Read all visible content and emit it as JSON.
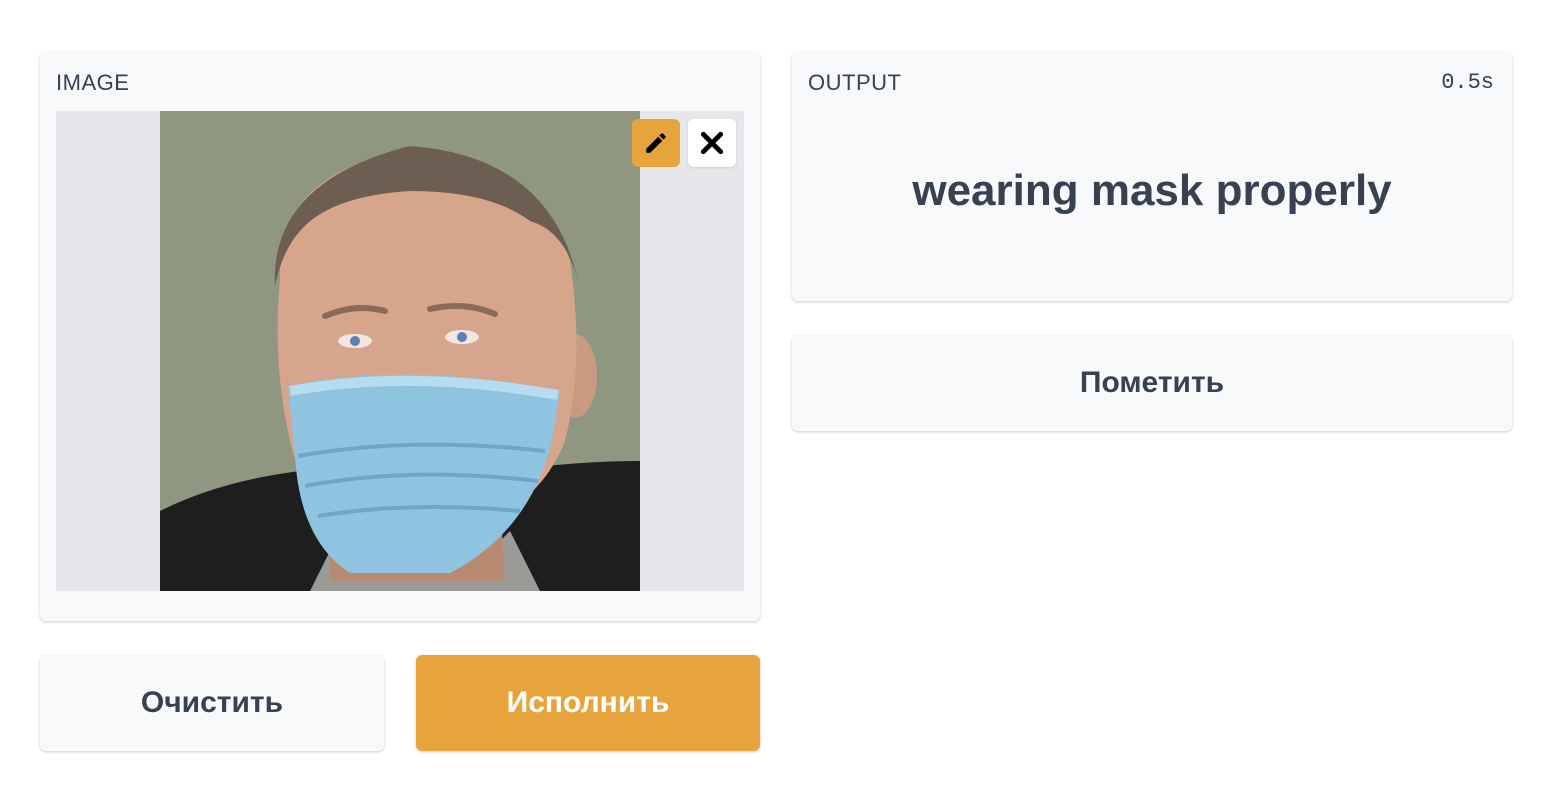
{
  "input_panel": {
    "label": "IMAGE",
    "image_description_icon": "uploaded-face-photo",
    "tools": {
      "edit_icon": "pencil-icon",
      "remove_icon": "close-icon"
    }
  },
  "output_panel": {
    "label": "OUTPUT",
    "timing": "0.5s",
    "result": "wearing mask properly"
  },
  "buttons": {
    "flag": "Пометить",
    "reset": "Очистить",
    "submit": "Исполнить"
  },
  "colors": {
    "accent": "#e8a43c",
    "panel_bg": "#f8f9fa",
    "text": "#374151",
    "image_bg": "#e5e7eb"
  }
}
